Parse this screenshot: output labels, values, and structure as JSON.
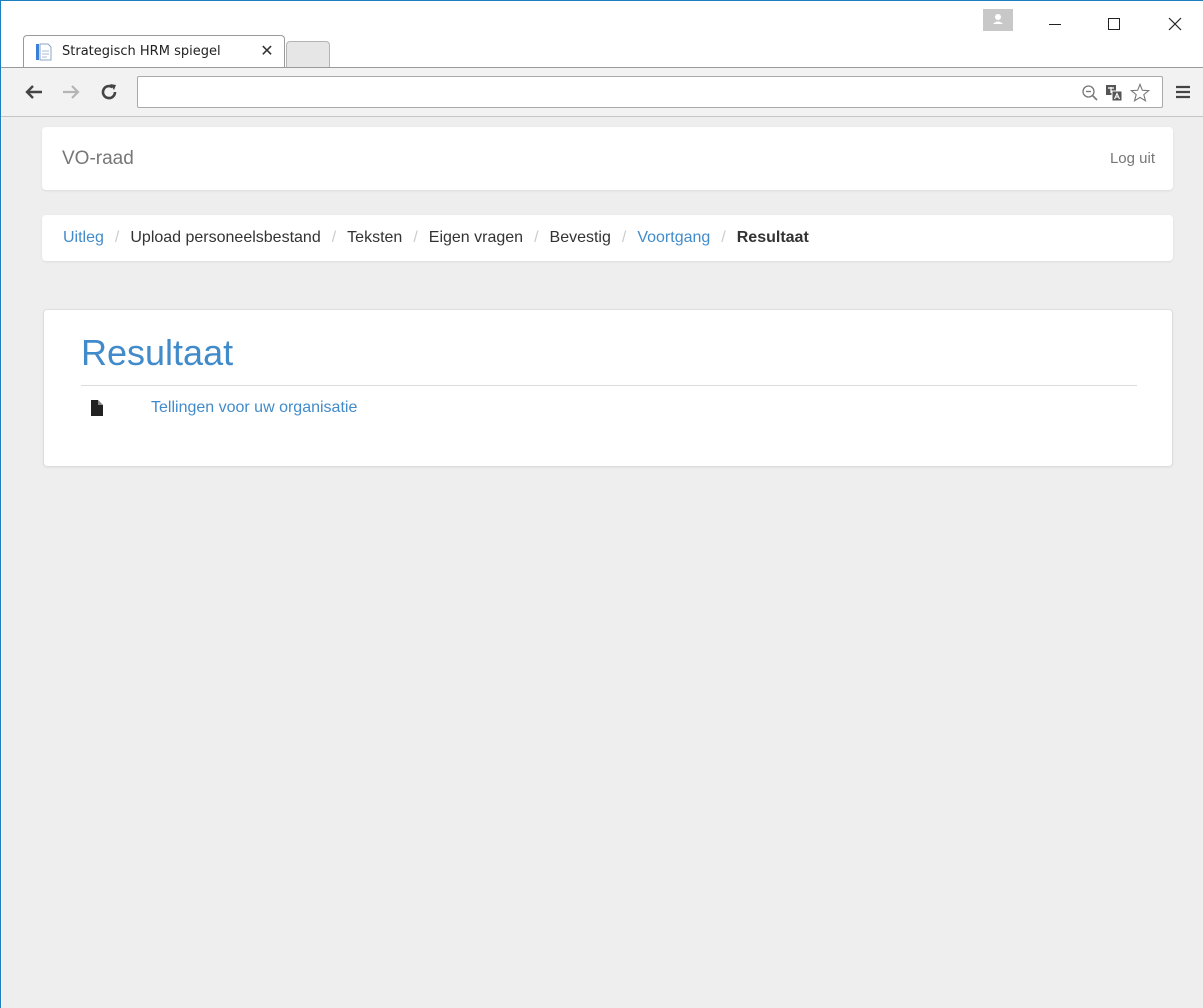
{
  "browser": {
    "tab_title": "Strategisch HRM spiegel",
    "tab_close_glyph": "✕",
    "address_value": "",
    "icons": [
      "back-arrow-icon",
      "forward-arrow-icon",
      "reload-icon",
      "zoom-icon",
      "translate-icon",
      "star-icon",
      "menu-icon"
    ]
  },
  "navbar": {
    "brand": "VO-raad",
    "logout": "Log uit"
  },
  "breadcrumb": {
    "items": [
      {
        "label": "Uitleg",
        "state": "link"
      },
      {
        "label": "Upload personeelsbestand",
        "state": "plain"
      },
      {
        "label": "Teksten",
        "state": "plain"
      },
      {
        "label": "Eigen vragen",
        "state": "plain"
      },
      {
        "label": "Bevestig",
        "state": "plain"
      },
      {
        "label": "Voortgang",
        "state": "link"
      },
      {
        "label": "Resultaat",
        "state": "active"
      }
    ],
    "separator": "/"
  },
  "panel": {
    "title": "Resultaat",
    "links": [
      {
        "label": "Tellingen voor uw organisatie",
        "icon": "file-icon"
      }
    ]
  },
  "colors": {
    "accent": "#428bca",
    "page_background": "#eeeeee",
    "window_border": "#1c7fbf"
  }
}
